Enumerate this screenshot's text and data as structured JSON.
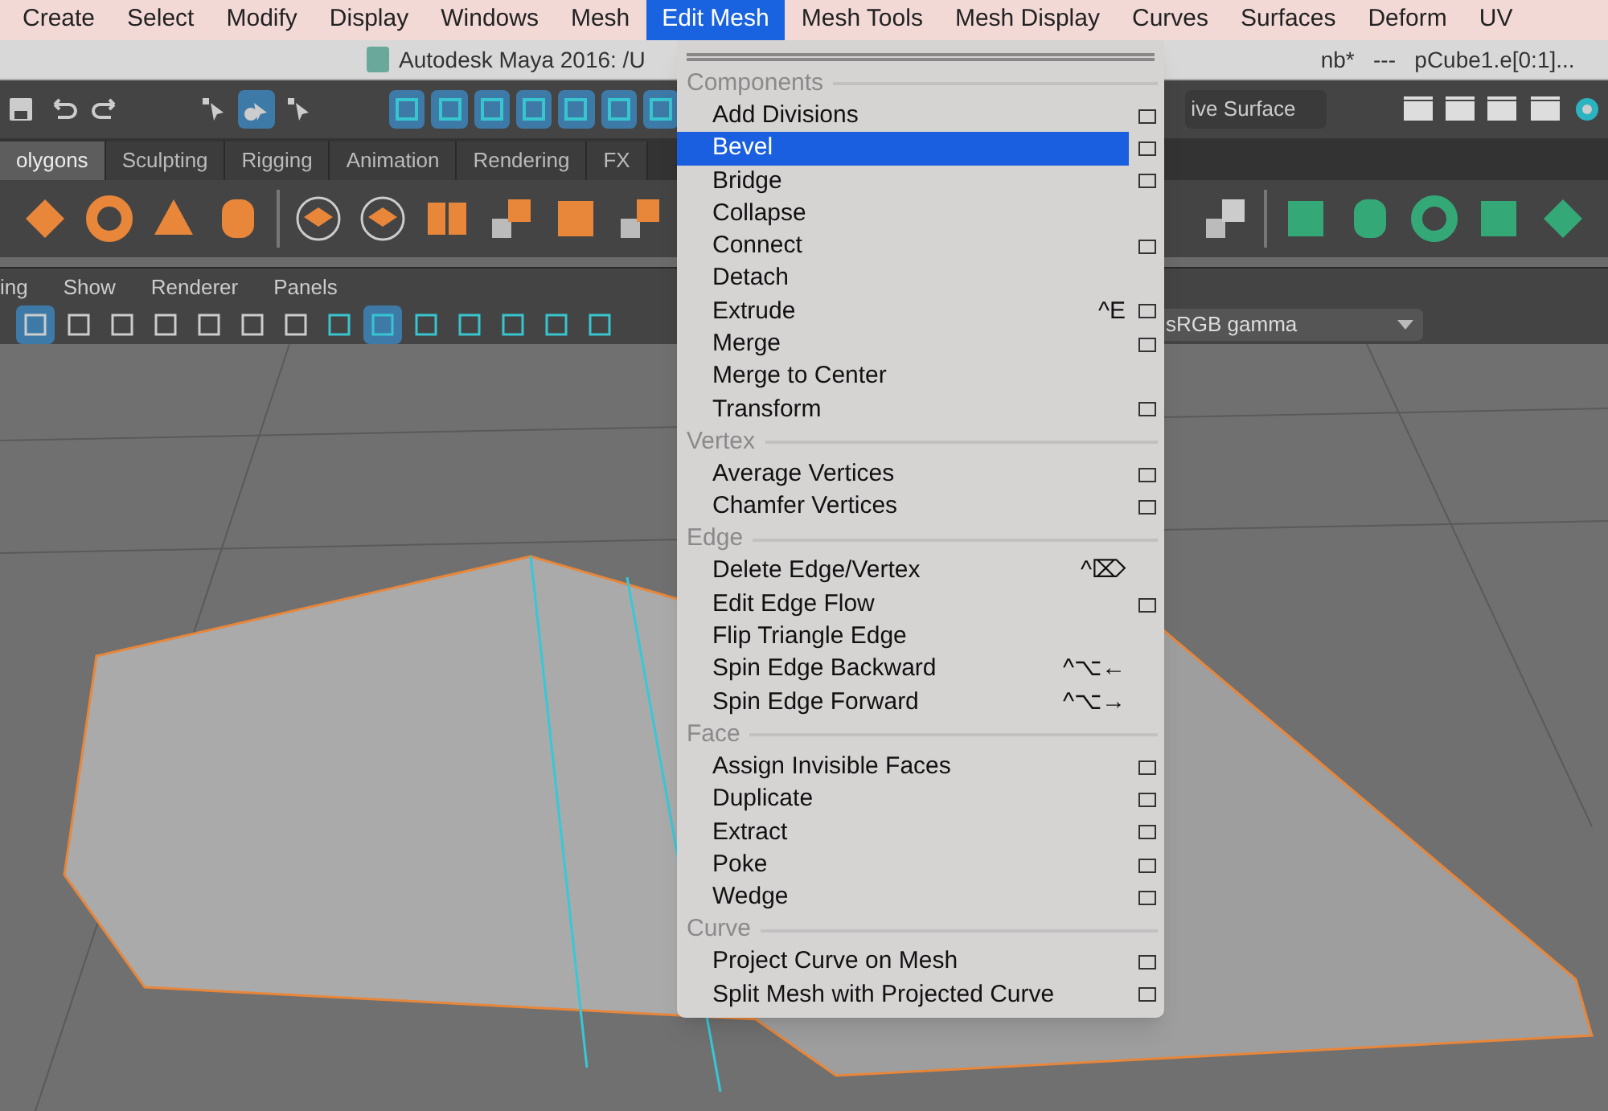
{
  "menu_bar": [
    {
      "label": "Create",
      "selected": false
    },
    {
      "label": "Select",
      "selected": false
    },
    {
      "label": "Modify",
      "selected": false
    },
    {
      "label": "Display",
      "selected": false
    },
    {
      "label": "Windows",
      "selected": false
    },
    {
      "label": "Mesh",
      "selected": false
    },
    {
      "label": "Edit Mesh",
      "selected": true
    },
    {
      "label": "Mesh Tools",
      "selected": false
    },
    {
      "label": "Mesh Display",
      "selected": false
    },
    {
      "label": "Curves",
      "selected": false
    },
    {
      "label": "Surfaces",
      "selected": false
    },
    {
      "label": "Deform",
      "selected": false
    },
    {
      "label": "UV",
      "selected": false
    }
  ],
  "title_bar": {
    "left": "Autodesk Maya 2016: /U",
    "right": "nb*   ---   pCube1.e[0:1]..."
  },
  "toolbar": {
    "field_value": "ive Surface"
  },
  "shelf_tabs": [
    {
      "label": "olygons",
      "selected": true
    },
    {
      "label": "Sculpting",
      "selected": false
    },
    {
      "label": "Rigging",
      "selected": false
    },
    {
      "label": "Animation",
      "selected": false
    },
    {
      "label": "Rendering",
      "selected": false
    },
    {
      "label": "FX",
      "selected": false
    }
  ],
  "panel_menu": [
    "ing",
    "Show",
    "Renderer",
    "Panels"
  ],
  "color_space": "sRGB gamma",
  "dropdown_menu": {
    "sections": [
      {
        "title": "Components",
        "items": [
          {
            "label": "Add Divisions",
            "option_box": true,
            "selected": false
          },
          {
            "label": "Bevel",
            "option_box": true,
            "selected": true
          },
          {
            "label": "Bridge",
            "option_box": true,
            "selected": false
          },
          {
            "label": "Collapse",
            "option_box": false,
            "selected": false
          },
          {
            "label": "Connect",
            "option_box": true,
            "selected": false
          },
          {
            "label": "Detach",
            "option_box": false,
            "selected": false
          },
          {
            "label": "Extrude",
            "shortcut": "^E",
            "option_box": true,
            "selected": false
          },
          {
            "label": "Merge",
            "option_box": true,
            "selected": false
          },
          {
            "label": "Merge to Center",
            "option_box": false,
            "selected": false
          },
          {
            "label": "Transform",
            "option_box": true,
            "selected": false
          }
        ]
      },
      {
        "title": "Vertex",
        "items": [
          {
            "label": "Average Vertices",
            "option_box": true,
            "selected": false
          },
          {
            "label": "Chamfer Vertices",
            "option_box": true,
            "selected": false
          }
        ]
      },
      {
        "title": "Edge",
        "items": [
          {
            "label": "Delete Edge/Vertex",
            "shortcut": "^⌦",
            "option_box": false,
            "selected": false
          },
          {
            "label": "Edit Edge Flow",
            "option_box": true,
            "selected": false
          },
          {
            "label": "Flip Triangle Edge",
            "option_box": false,
            "selected": false
          },
          {
            "label": "Spin Edge Backward",
            "shortcut": "^⌥←",
            "option_box": false,
            "selected": false
          },
          {
            "label": "Spin Edge Forward",
            "shortcut": "^⌥→",
            "option_box": false,
            "selected": false
          }
        ]
      },
      {
        "title": "Face",
        "items": [
          {
            "label": "Assign Invisible Faces",
            "option_box": true,
            "selected": false
          },
          {
            "label": "Duplicate",
            "option_box": true,
            "selected": false
          },
          {
            "label": "Extract",
            "option_box": true,
            "selected": false
          },
          {
            "label": "Poke",
            "option_box": true,
            "selected": false
          },
          {
            "label": "Wedge",
            "option_box": true,
            "selected": false
          }
        ]
      },
      {
        "title": "Curve",
        "items": [
          {
            "label": "Project Curve on Mesh",
            "option_box": true,
            "selected": false
          },
          {
            "label": "Split Mesh with Projected Curve",
            "option_box": true,
            "selected": false
          }
        ]
      }
    ]
  }
}
